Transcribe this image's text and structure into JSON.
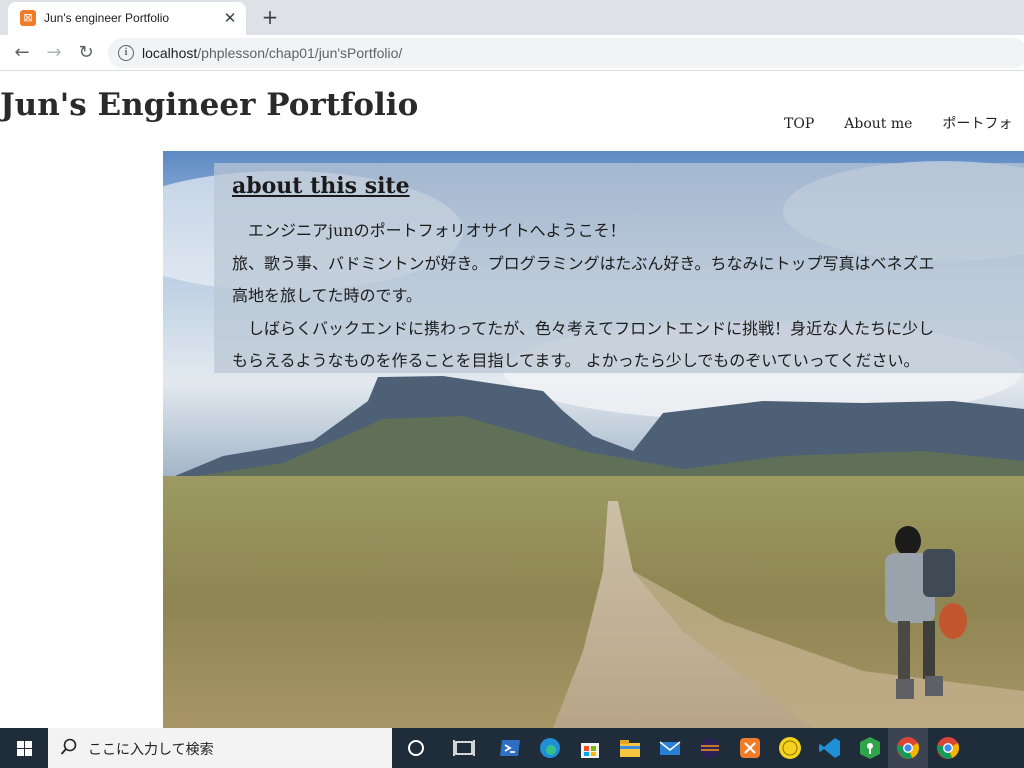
{
  "browser": {
    "tab_title": "Jun's engineer Portfolio",
    "tab_close": "✕",
    "new_tab": "+",
    "url_host": "localhost",
    "url_path": "/phplesson/chap01/jun'sPortfolio/",
    "back": "←",
    "forward": "→",
    "reload": "↻"
  },
  "site": {
    "title": "Jun's Engineer Portfolio",
    "nav": [
      {
        "label": "TOP"
      },
      {
        "label": "About me"
      },
      {
        "label": "ポートフォ"
      }
    ],
    "about": {
      "heading": "about this site",
      "lines": [
        "　エンジニアjunのポートフォリオサイトへようこそ！",
        "旅、歌う事、バドミントンが好き。プログラミングはたぶん好き。ちなみにトップ写真はベネズエ",
        "高地を旅してた時のです。",
        "　しばらくバックエンドに携わってたが、色々考えてフロントエンドに挑戦！身近な人たちに少し",
        "もらえるようなものを作ることを目指してます。 よかったら少しでものぞいていってください。"
      ]
    }
  },
  "taskbar": {
    "search_placeholder": "ここに入力して検索",
    "icons": [
      "search-icon",
      "cortana-icon",
      "task-view-icon",
      "powershell-icon",
      "edge-icon",
      "store-icon",
      "file-explorer-icon",
      "mail-icon",
      "eclipse-icon",
      "xampp-icon",
      "ok-app-icon",
      "vscode-icon",
      "keepass-icon",
      "chrome-icon",
      "chrome-icon"
    ]
  }
}
